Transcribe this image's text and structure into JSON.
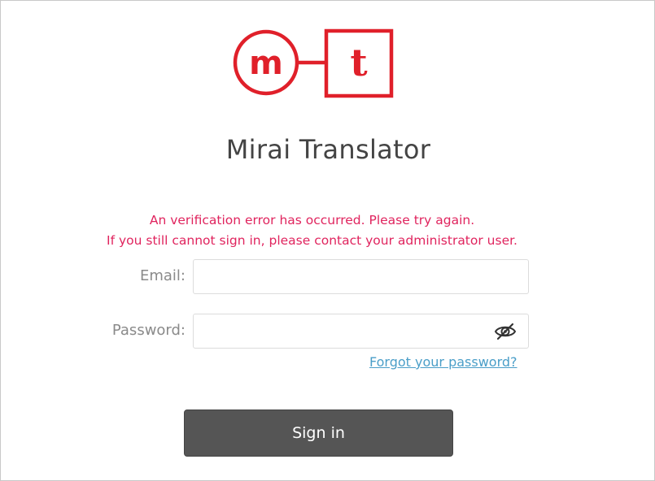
{
  "app": {
    "title": "Mirai Translator"
  },
  "logo": {
    "left_letter": "m",
    "right_letter": "t",
    "color": "#e0202a"
  },
  "error": {
    "line1": "An verification error has occurred. Please try again.",
    "line2": "If you still cannot sign in, please contact your administrator user."
  },
  "form": {
    "email_label": "Email:",
    "email_value": "",
    "password_label": "Password:",
    "password_value": "",
    "password_toggle_icon": "eye-slash-icon",
    "forgot_link": "Forgot your password?",
    "signin_label": "Sign in"
  },
  "colors": {
    "error_text": "#e0245e",
    "link": "#4a9ec8",
    "button_bg": "#555555"
  }
}
